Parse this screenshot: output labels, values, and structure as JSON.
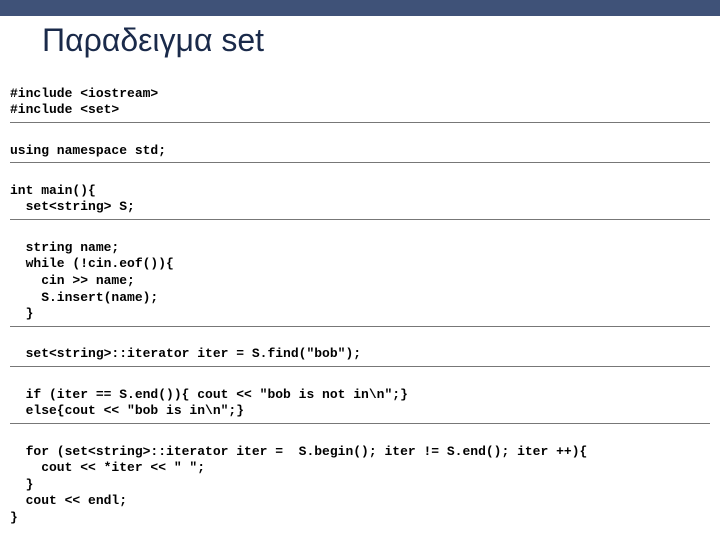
{
  "title": "Παραδειγμα set",
  "code": {
    "l01": "#include <iostream>",
    "l02": "#include <set>",
    "l03": "using namespace std;",
    "l04": "int main(){",
    "l05": "  set<string> S;",
    "l06": "  string name;",
    "l07": "  while (!cin.eof()){",
    "l08": "    cin >> name;",
    "l09": "    S.insert(name);",
    "l10": "  }",
    "l11": "  set<string>::iterator iter = S.find(\"bob\");",
    "l12": "  if (iter == S.end()){ cout << \"bob is not in\\n\";}",
    "l13": "  else{cout << \"bob is in\\n\";}",
    "l14": "  for (set<string>::iterator iter =  S.begin(); iter != S.end(); iter ++){",
    "l15": "    cout << *iter << \" \";",
    "l16": "  }",
    "l17": "  cout << endl;",
    "l18": "}"
  }
}
